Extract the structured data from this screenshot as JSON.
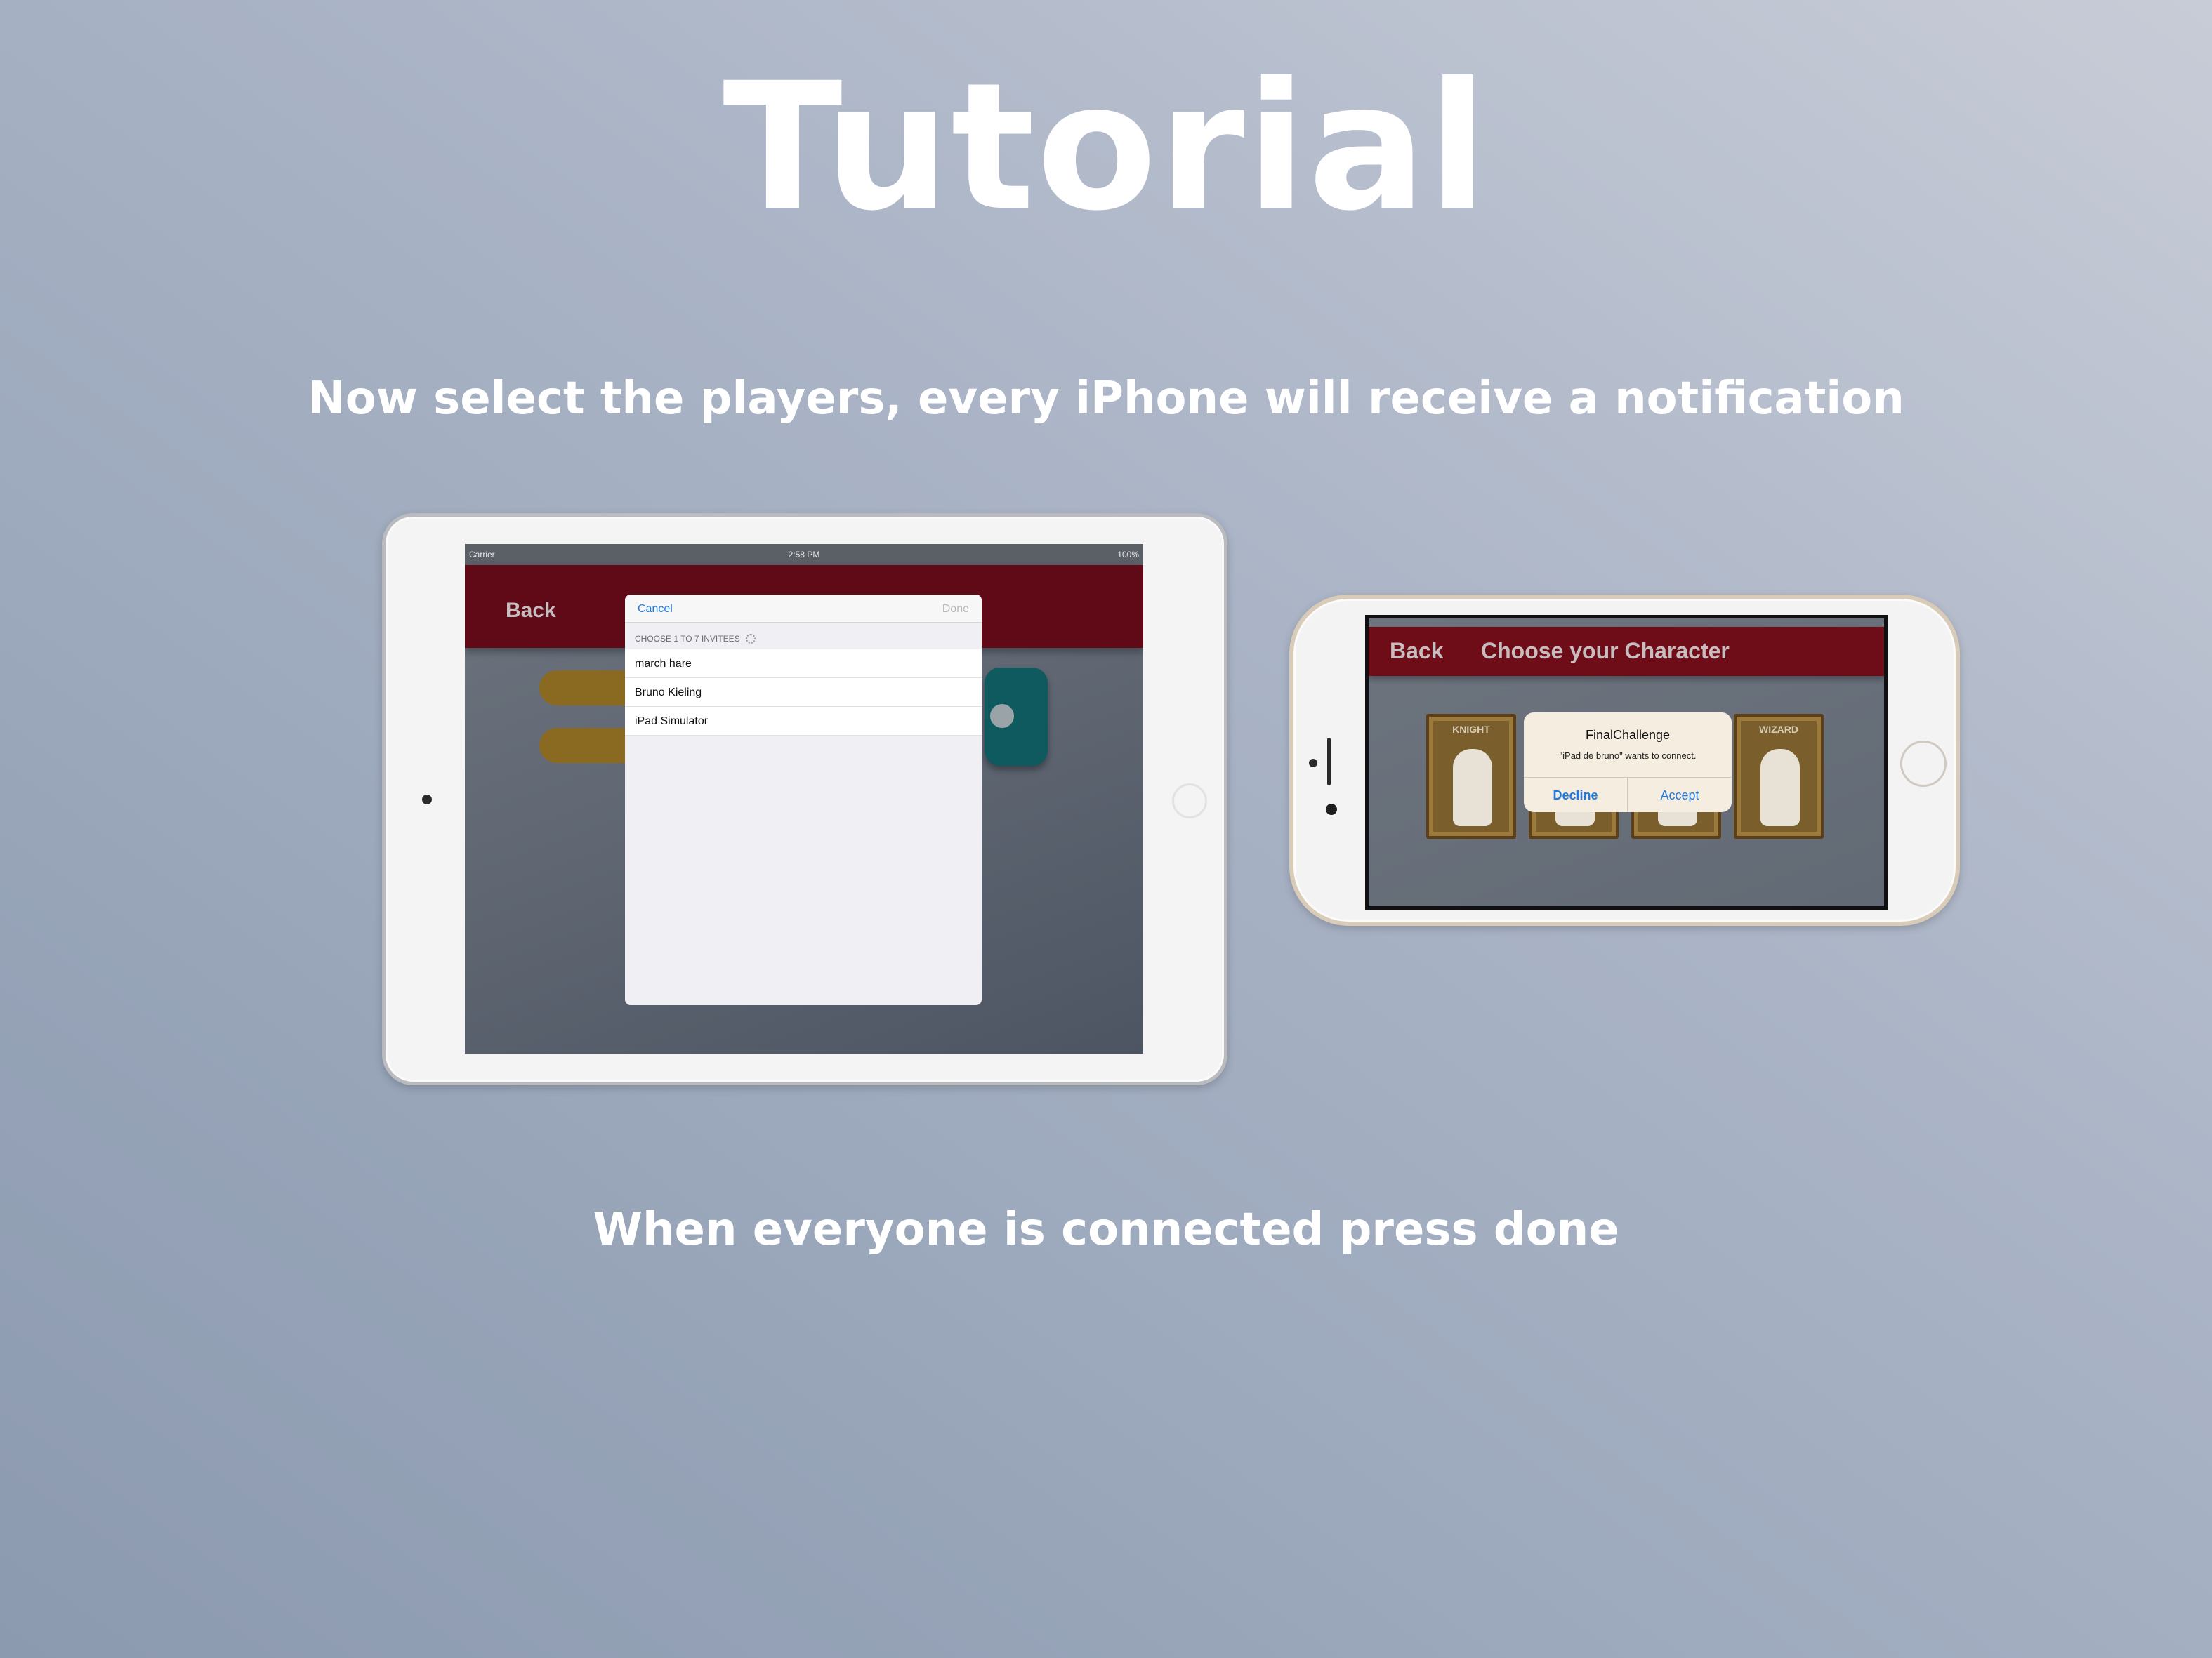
{
  "slide": {
    "title": "Tutorial",
    "subtitle": "Now select the players, every iPhone will receive a notification",
    "caption": "When everyone is connected press done"
  },
  "ipad": {
    "status_bar": {
      "carrier": "Carrier",
      "time": "2:58 PM",
      "battery": "100%"
    },
    "nav": {
      "back_label": "Back"
    },
    "invite_sheet": {
      "cancel_label": "Cancel",
      "done_label": "Done",
      "section_header": "CHOOSE 1 TO 7 INVITEES",
      "players": [
        "march hare",
        "Bruno Kieling",
        "iPad Simulator"
      ]
    }
  },
  "iphone": {
    "nav": {
      "back_label": "Back",
      "title": "Choose your Character"
    },
    "cards": [
      "KNIGHT",
      "",
      "",
      "WIZARD"
    ],
    "alert": {
      "title": "FinalChallenge",
      "message": "\"iPad de bruno\" wants to connect.",
      "decline_label": "Decline",
      "accept_label": "Accept"
    }
  },
  "colors": {
    "nav_red": "#6e0d18",
    "link_blue": "#1f7ae0",
    "pill_gold": "#8a6a21",
    "teal": "#0f5a5e"
  }
}
